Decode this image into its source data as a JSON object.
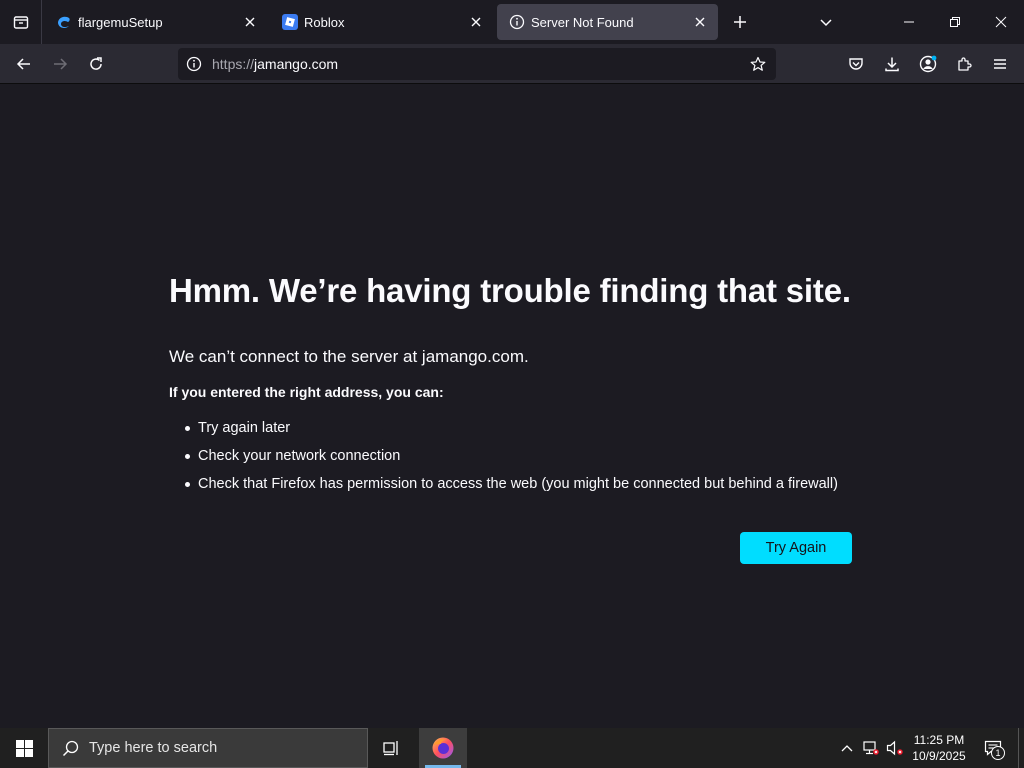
{
  "browser": {
    "tabs": [
      {
        "title": "flargemuSetup",
        "active": false,
        "favicon": "edge-blue-icon"
      },
      {
        "title": "Roblox",
        "active": false,
        "favicon": "roblox-icon"
      },
      {
        "title": "Server Not Found",
        "active": true,
        "favicon": "info-icon"
      }
    ],
    "url": {
      "scheme": "https://",
      "host": "jamango.com"
    }
  },
  "error_page": {
    "heading": "Hmm. We’re having trouble finding that site.",
    "message": "We can’t connect to the server at jamango.com.",
    "suggestions_title": "If you entered the right address, you can:",
    "suggestions": [
      "Try again later",
      "Check your network connection",
      "Check that Firefox has permission to access the web (you might be connected but behind a firewall)"
    ],
    "try_again_label": "Try Again"
  },
  "taskbar": {
    "search_placeholder": "Type here to search",
    "time": "11:25 PM",
    "date": "10/9/2025",
    "notification_count": "1"
  },
  "colors": {
    "page_bg": "#1c1b22",
    "toolbar_bg": "#2b2a33",
    "active_tab_bg": "#42414d",
    "accent_button": "#00ddff",
    "taskbar_bg": "#202020"
  }
}
